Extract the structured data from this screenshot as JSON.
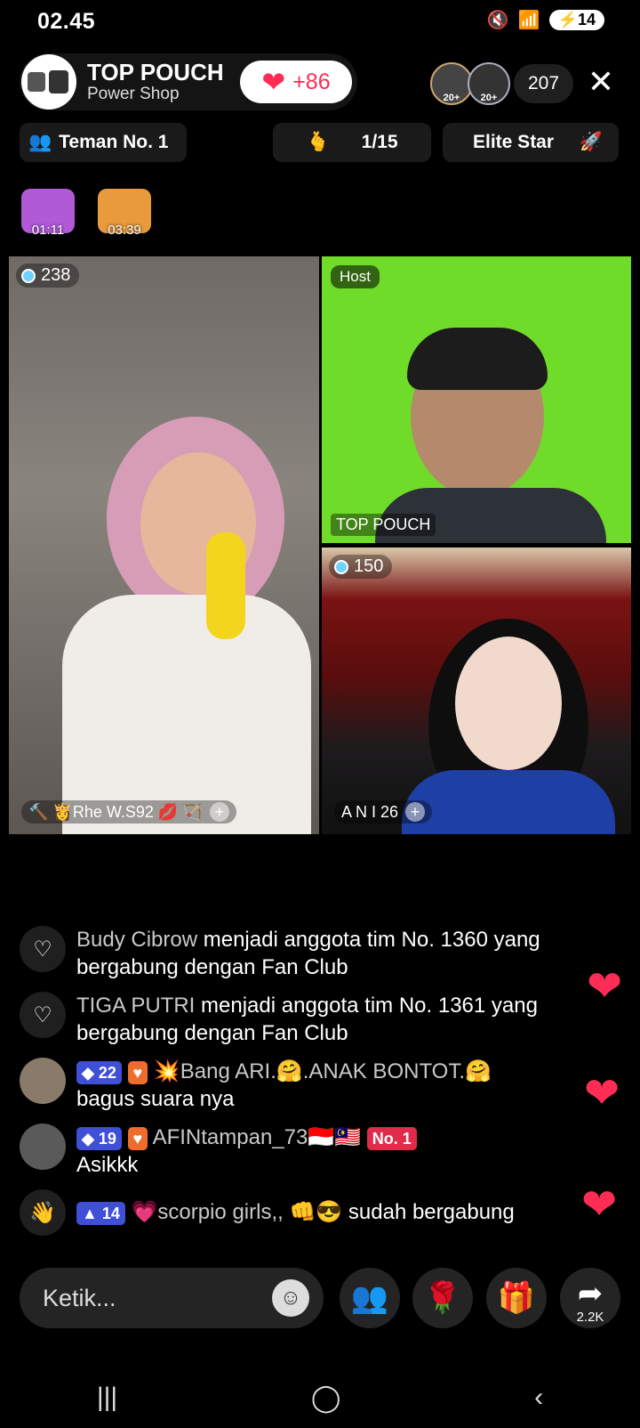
{
  "status_bar": {
    "time": "02.45",
    "battery": "14"
  },
  "header": {
    "host_name": "TOP POUCH",
    "host_subtitle": "Power Shop",
    "likes": "+86",
    "viewer_badges": [
      "20+",
      "20+"
    ],
    "viewer_count": "207"
  },
  "chips": {
    "team": "Teman No. 1",
    "rank": "1/15",
    "elite": "Elite Star"
  },
  "gifts": [
    {
      "time": "01:11",
      "color": "#b05ad8"
    },
    {
      "time": "03:39",
      "color": "#e89a3c"
    }
  ],
  "tiles": {
    "left": {
      "score": "238",
      "name": "🔨 👸Rhe W.S92 💋 🏹"
    },
    "host": {
      "tag": "Host",
      "name": "TOP POUCH"
    },
    "right": {
      "score": "150",
      "name": "A N I 26"
    }
  },
  "chat": [
    {
      "icon": "heart-outline",
      "user": "Budy Cibrow",
      "text": " menjadi anggota tim No. 1360 yang bergabung dengan Fan Club"
    },
    {
      "icon": "heart-outline",
      "user": "TIGA PUTRI",
      "text": " menjadi anggota tim No. 1361 yang bergabung dengan Fan Club"
    },
    {
      "icon": "avatar",
      "level": "22",
      "user": "💥Bang ARI.🤗.ANAK BONTOT.🤗",
      "text": "bagus suara nya"
    },
    {
      "icon": "avatar",
      "level": "19",
      "user": "AFINtampan_73🇮🇩🇲🇾",
      "badge": "No. 1",
      "text": "Asikkk"
    },
    {
      "icon": "wave",
      "level": "14",
      "user": "💗scorpio girls,, 👊😎",
      "text": " sudah bergabung"
    }
  ],
  "input": {
    "placeholder": "Ketik..."
  },
  "share_count": "2.2K",
  "colors": {
    "accent": "#fe2c55",
    "green_screen": "#6fdc2a"
  }
}
